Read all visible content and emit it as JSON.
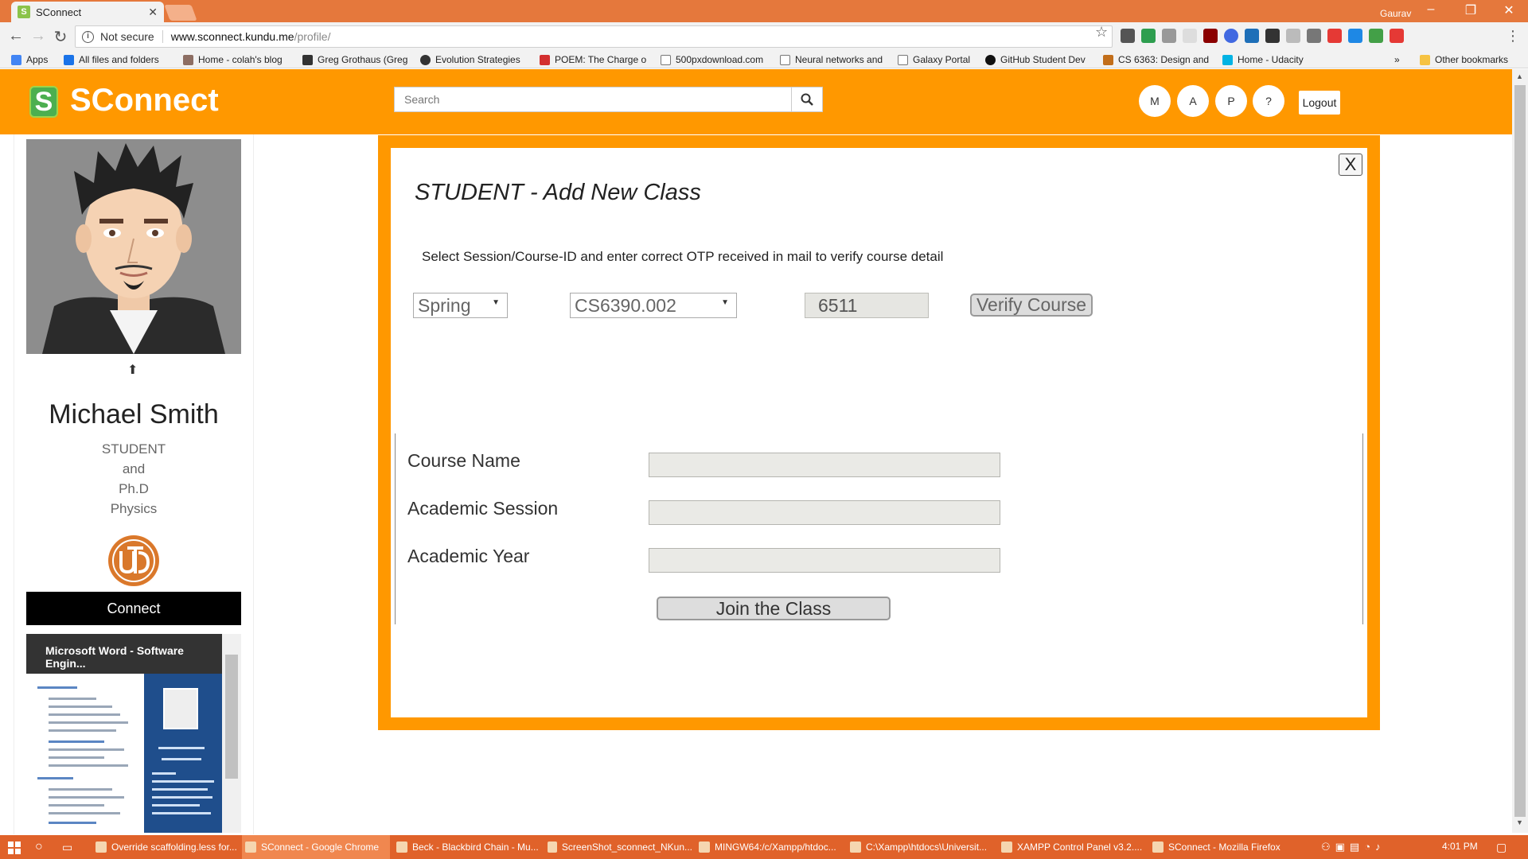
{
  "browser": {
    "tab_title": "SConnect",
    "user_name": "Gaurav",
    "not_secure": "Not secure",
    "url_host": "www.sconnect.kundu.me",
    "url_path": "/profile/",
    "bookmarks": [
      {
        "label": "Apps",
        "icon": "apps-grid-icon"
      },
      {
        "label": "All files and folders",
        "icon": "box-icon"
      },
      {
        "label": "Home - colah's blog",
        "icon": "page-icon"
      },
      {
        "label": "Greg Grothaus (Greg",
        "icon": "mountain-icon"
      },
      {
        "label": "Evolution Strategies",
        "icon": "openai-icon"
      },
      {
        "label": "POEM: The Charge o",
        "icon": "pen-icon"
      },
      {
        "label": "500pxdownload.com",
        "icon": "page-icon"
      },
      {
        "label": "Neural networks and",
        "icon": "page-icon"
      },
      {
        "label": "Galaxy Portal",
        "icon": "page-icon"
      },
      {
        "label": "GitHub Student Dev",
        "icon": "github-icon"
      },
      {
        "label": "CS 6363: Design and",
        "icon": "utd-icon"
      },
      {
        "label": "Home - Udacity",
        "icon": "udacity-icon"
      },
      {
        "label": "Other bookmarks",
        "icon": "folder-icon"
      }
    ]
  },
  "header": {
    "logo_letter": "S",
    "brand": "SConnect",
    "search_placeholder": "Search",
    "nav_buttons": [
      "M",
      "A",
      "P",
      "?"
    ],
    "logout": "Logout"
  },
  "profile": {
    "name": "Michael Smith",
    "role_lines": [
      "STUDENT",
      "and",
      "Ph.D",
      "Physics"
    ],
    "connect": "Connect",
    "preview_title": "Microsoft Word - Software Engin..."
  },
  "modal": {
    "close": "X",
    "title": "STUDENT - Add New Class",
    "instructions": "Select Session/Course-ID and enter correct OTP received in mail to verify course detail",
    "session_value": "Spring",
    "course_value": "CS6390.002",
    "otp_value": "6511",
    "verify_button": "Verify Course",
    "fields": [
      {
        "label": "Course Name",
        "value": ""
      },
      {
        "label": "Academic Session",
        "value": ""
      },
      {
        "label": "Academic Year",
        "value": ""
      }
    ],
    "join_button": "Join the Class"
  },
  "taskbar": {
    "items": [
      {
        "label": "Override scaffolding.less for...",
        "active": false
      },
      {
        "label": "SConnect - Google Chrome",
        "active": true
      },
      {
        "label": "Beck - Blackbird Chain - Mu...",
        "active": false
      },
      {
        "label": "ScreenShot_sconnect_NKun...",
        "active": false
      },
      {
        "label": "MINGW64:/c/Xampp/htdoc...",
        "active": false
      },
      {
        "label": "C:\\Xampp\\htdocs\\Universit...",
        "active": false
      },
      {
        "label": "XAMPP Control Panel v3.2....",
        "active": false
      },
      {
        "label": "SConnect - Mozilla Firefox",
        "active": false
      }
    ],
    "clock": "4:01 PM"
  },
  "colors": {
    "brand_orange": "#ff9800",
    "title_bar": "#e5783c",
    "taskbar": "#e0622a"
  }
}
